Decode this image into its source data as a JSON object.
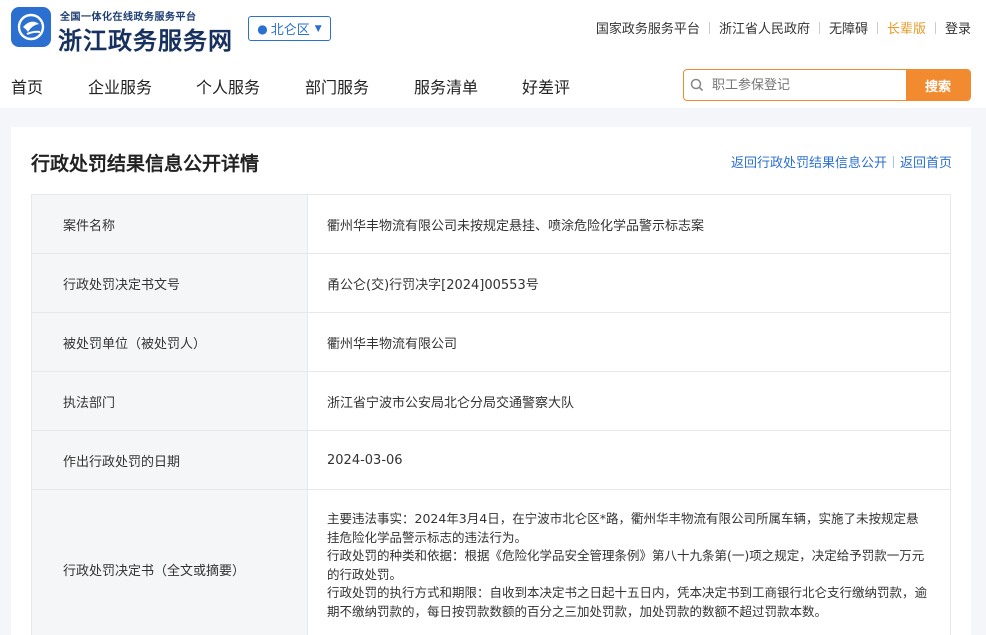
{
  "header": {
    "logo_sub": "全国一体化在线政务服务平台",
    "logo_title": "浙江政务服务网",
    "region": "北仑区",
    "top_links": [
      "国家政务服务平台",
      "浙江省人民政府",
      "无障碍",
      "长辈版",
      "登录"
    ]
  },
  "nav": {
    "items": [
      "首页",
      "企业服务",
      "个人服务",
      "部门服务",
      "服务清单",
      "好差评"
    ]
  },
  "search": {
    "placeholder": "职工参保登记",
    "button": "搜索"
  },
  "page": {
    "title": "行政处罚结果信息公开详情",
    "back_link": "返回行政处罚结果信息公开",
    "home_link": "返回首页"
  },
  "details": [
    {
      "label": "案件名称",
      "value": "衢州华丰物流有限公司未按规定悬挂、喷涂危险化学品警示标志案"
    },
    {
      "label": "行政处罚决定书文号",
      "value": "甬公仑(交)行罚决字[2024]00553号"
    },
    {
      "label": "被处罚单位（被处罚人）",
      "value": "衢州华丰物流有限公司"
    },
    {
      "label": "执法部门",
      "value": "浙江省宁波市公安局北仑分局交通警察大队"
    },
    {
      "label": "作出行政处罚的日期",
      "value": "2024-03-06"
    }
  ],
  "decision": {
    "label": "行政处罚决定书（全文或摘要）",
    "paragraphs": [
      "主要违法事实：2024年3月4日，在宁波市北仑区*路，衢州华丰物流有限公司所属车辆，实施了未按规定悬挂危险化学品警示标志的违法行为。",
      "行政处罚的种类和依据：根据《危险化学品安全管理条例》第八十九条第(一)项之规定，决定给予罚款一万元的行政处罚。",
      "行政处罚的执行方式和期限：自收到本决定书之日起十五日内，凭本决定书到工商银行北仑支行缴纳罚款，逾期不缴纳罚款的，每日按罚款数额的百分之三加处罚款，加处罚款的数额不超过罚款本数。"
    ]
  },
  "colors": {
    "brand_blue": "#2b6fd0",
    "search_orange": "#f28b30",
    "elder_orange": "#e69a26"
  }
}
